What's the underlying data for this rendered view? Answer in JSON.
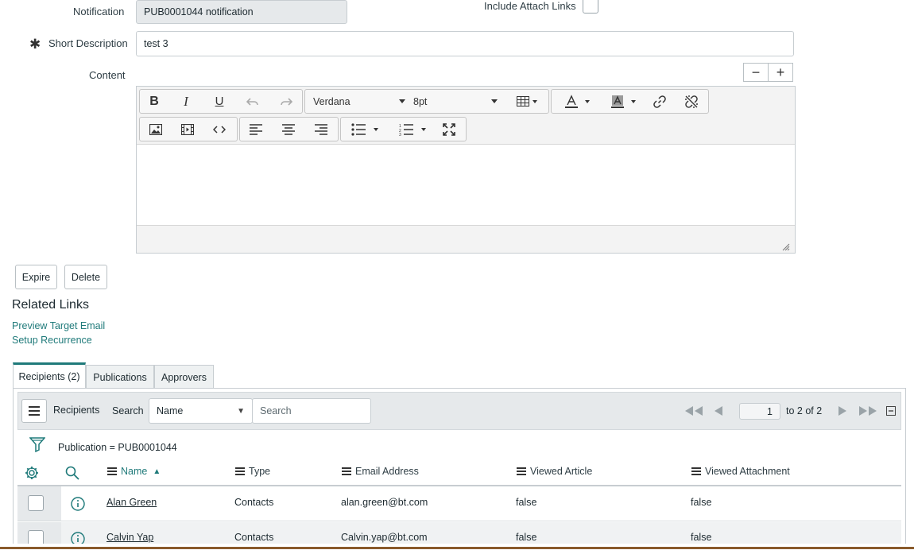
{
  "form": {
    "notification_label": "Notification",
    "notification_value": "PUB0001044 notification",
    "include_attach_label": "Include Attach Links",
    "required_mark": "✱",
    "short_desc_label": "Short Description",
    "short_desc_value": "test 3",
    "content_label": "Content",
    "collapse_label": "−",
    "expand_label": "+"
  },
  "editor": {
    "bold": "B",
    "italic": "I",
    "underline": "U",
    "font_family": "Verdana",
    "font_size": "8pt"
  },
  "actions": {
    "expire": "Expire",
    "delete": "Delete"
  },
  "related": {
    "heading": "Related Links",
    "links": [
      "Preview Target Email",
      "Setup Recurrence"
    ]
  },
  "tabs": [
    "Recipients (2)",
    "Publications",
    "Approvers"
  ],
  "list": {
    "title": "Recipients",
    "search_label": "Search",
    "search_field": "Name",
    "search_placeholder": "Search",
    "page_value": "1",
    "page_range": "to 2 of 2",
    "filter_text": "Publication = PUB0001044",
    "columns": [
      "Name",
      "Type",
      "Email Address",
      "Viewed Article",
      "Viewed Attachment"
    ],
    "rows": [
      {
        "name": "Alan Green",
        "type": "Contacts",
        "email": "alan.green@bt.com",
        "viewed_article": "false",
        "viewed_attachment": "false"
      },
      {
        "name": "Calvin Yap",
        "type": "Contacts",
        "email": "Calvin.yap@bt.com",
        "viewed_article": "false",
        "viewed_attachment": "false"
      }
    ]
  },
  "colors": {
    "accent": "#1f7a7a",
    "toolbar_bg": "#f3f3f3",
    "list_header_bg": "#e6e9eb",
    "bottom_border": "#8a5a2b"
  }
}
